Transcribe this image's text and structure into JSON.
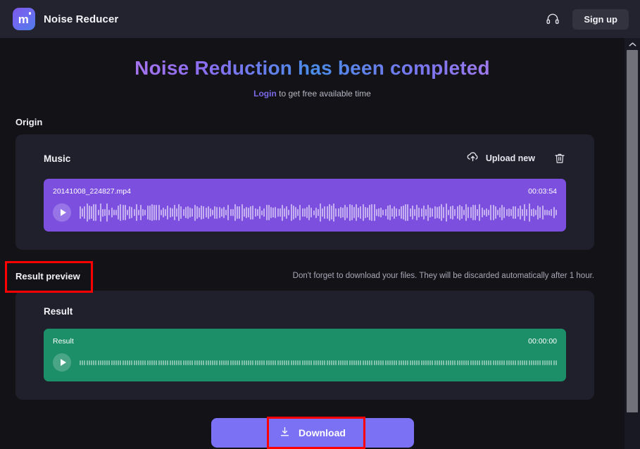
{
  "header": {
    "brand_title": "Noise Reducer",
    "logo_letter": "m",
    "support_icon": "headset-icon",
    "signup_label": "Sign up"
  },
  "hero": {
    "headline": "Noise Reduction has been completed",
    "sub_link": "Login",
    "sub_text": " to get free available time"
  },
  "origin": {
    "section_label": "Origin",
    "card_title": "Music",
    "upload_label": "Upload new",
    "upload_icon": "cloud-upload-icon",
    "delete_icon": "trash-icon",
    "track": {
      "name": "20141008_224827.mp4",
      "duration": "00:03:54",
      "play_icon": "play-icon"
    }
  },
  "result": {
    "section_label": "Result preview",
    "note": "Don't forget to download your files. They will be discarded automatically after 1 hour.",
    "card_title": "Result",
    "track": {
      "name": "Result",
      "duration": "00:00:00",
      "play_icon": "play-icon"
    }
  },
  "footer": {
    "download_label": "Download",
    "download_icon": "download-icon"
  },
  "colors": {
    "accent_purple": "#7b71f5",
    "origin_track": "#7c4fdf",
    "result_track": "#1c8f68",
    "annotation_red": "#ff0000",
    "page_bg": "#121217",
    "card_bg": "#20202c",
    "header_bg": "#23232f"
  }
}
